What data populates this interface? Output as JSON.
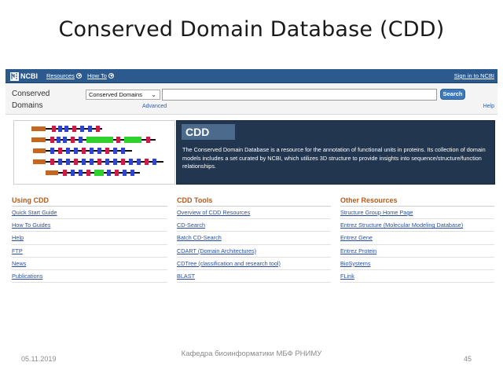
{
  "slide": {
    "title": "Conserved Domain Database (CDD)",
    "footer_date": "05.11.2019",
    "footer_center": "Кафедра биоинформатики МБФ РНИМУ",
    "page_number": "45"
  },
  "ncbi_bar": {
    "logo": "NCBI",
    "resources": "Resources",
    "how_to": "How To",
    "sign_in": "Sign in to NCBI"
  },
  "search": {
    "db_name_line1": "Conserved",
    "db_name_line2": "Domains",
    "db_select": "Conserved Domains",
    "query_value": "",
    "button": "Search",
    "advanced": "Advanced",
    "help": "Help"
  },
  "hero": {
    "title": "CDD",
    "description": "The Conserved Domain Database is a resource for the annotation of functional units in proteins. Its collection of domain models includes a set curated by NCBI, which utilizes 3D structure to provide insights into sequence/structure/function relationships."
  },
  "columns": [
    {
      "heading": "Using CDD",
      "links": [
        "Quick Start Guide",
        "How To Guides",
        "Help",
        "FTP",
        "News",
        "Publications"
      ]
    },
    {
      "heading": "CDD Tools",
      "links": [
        "Overview of CDD Resources",
        "CD-Search",
        "Batch CD-Search",
        "CDART (Domain Architectures)",
        "CDTree (classification and research tool)",
        "BLAST"
      ]
    },
    {
      "heading": "Other Resources",
      "links": [
        "Structure Group Home Page",
        "Entrez Structure (Molecular Modeling Database)",
        "Entrez Gene",
        "Entrez Protein",
        "BioSystems",
        "FLink"
      ]
    }
  ],
  "colors": {
    "ncbi_blue": "#2d5a8e",
    "hero_bg": "#22364f",
    "heading_orange": "#b35c1e",
    "link_blue": "#2a4fa0"
  }
}
